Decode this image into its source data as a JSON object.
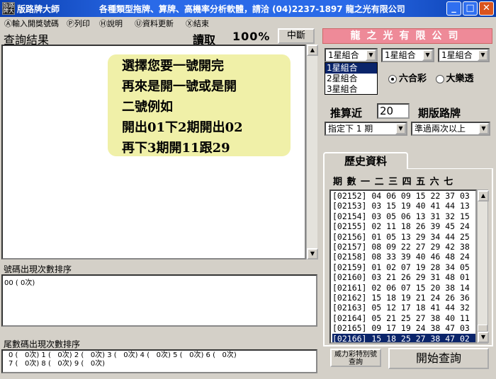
{
  "window": {
    "title": "版路牌大師",
    "marquee": "各種類型拖牌、算牌、高機率分析軟體，請洽 (04)2237-1897 龍之光有限公司",
    "minimize": "_",
    "maximize": "□",
    "close": "✕"
  },
  "menu": {
    "items": [
      "Ⓐ輸入開獎號碼",
      "Ⓟ列印",
      "Ⓗ說明",
      "Ⓤ資料更新",
      "Ⓧ結束"
    ]
  },
  "query": {
    "title": "查詢結果",
    "read_label": "讀取",
    "progress": "100%",
    "stop_label": "中斷"
  },
  "tip": {
    "lines": [
      "選擇您要一號開完",
      "再來是開一號或是開",
      "二號例如",
      "開出01下2期開出02",
      "再下3期開11跟29"
    ]
  },
  "freq": {
    "title": "號碼出現次數排序",
    "content": "00 (   0次)"
  },
  "tail": {
    "title": "尾數碼出現次數排序",
    "line1": "0 (   0次) 1 (   0次) 2 (   0次) 3 (   0次) 4 (   0次) 5 (   0次) 6 (   0次)",
    "line2": "7 (   0次) 8 (   0次) 9 (   0次)"
  },
  "right": {
    "company": "龍之光有限公司",
    "combo1": "1星組合",
    "combo2": "1星組合",
    "combo3": "1星組合",
    "dropdown_options": [
      "1星組合",
      "2星組合",
      "3星組合"
    ],
    "radio1": "六合彩",
    "radio2": "大樂透",
    "calc_label": "推算近",
    "period_value": "20",
    "board_label": "期版路牌",
    "period_combo": "指定下 1 期",
    "filter_combo": "準過兩次以上"
  },
  "history": {
    "tab_label": "歷史資料",
    "header": "期 數  一 二 三 四 五 六 七",
    "rows": [
      "[02152] 04 06 09 15 22 37 03",
      "[02153] 03 15 19 40 41 44 13",
      "[02154] 03 05 06 13 31 32 15",
      "[02155] 02 11 18 26 39 45 24",
      "[02156] 01 05 13 29 34 44 25",
      "[02157] 08 09 22 27 29 42 38",
      "[02158] 08 33 39 40 46 48 24",
      "[02159] 01 02 07 19 28 34 05",
      "[02160] 03 21 26 29 31 48 01",
      "[02161] 02 06 07 15 20 38 14",
      "[02162] 15 18 19 21 24 26 36",
      "[02163] 05 12 17 18 41 44 32",
      "[02164] 05 21 25 27 38 40 11",
      "[02165] 09 17 19 24 38 47 03",
      "[02166] 15 18 25 27 38 47 02"
    ],
    "special_button": "威力彩特別號\n查詢",
    "start_button": "開始查詢"
  },
  "colors": {
    "titlebar": "#2a6ae8",
    "banner": "#ee8a98",
    "tip_bg": "#f0f0a8",
    "selection": "#0a246a"
  }
}
